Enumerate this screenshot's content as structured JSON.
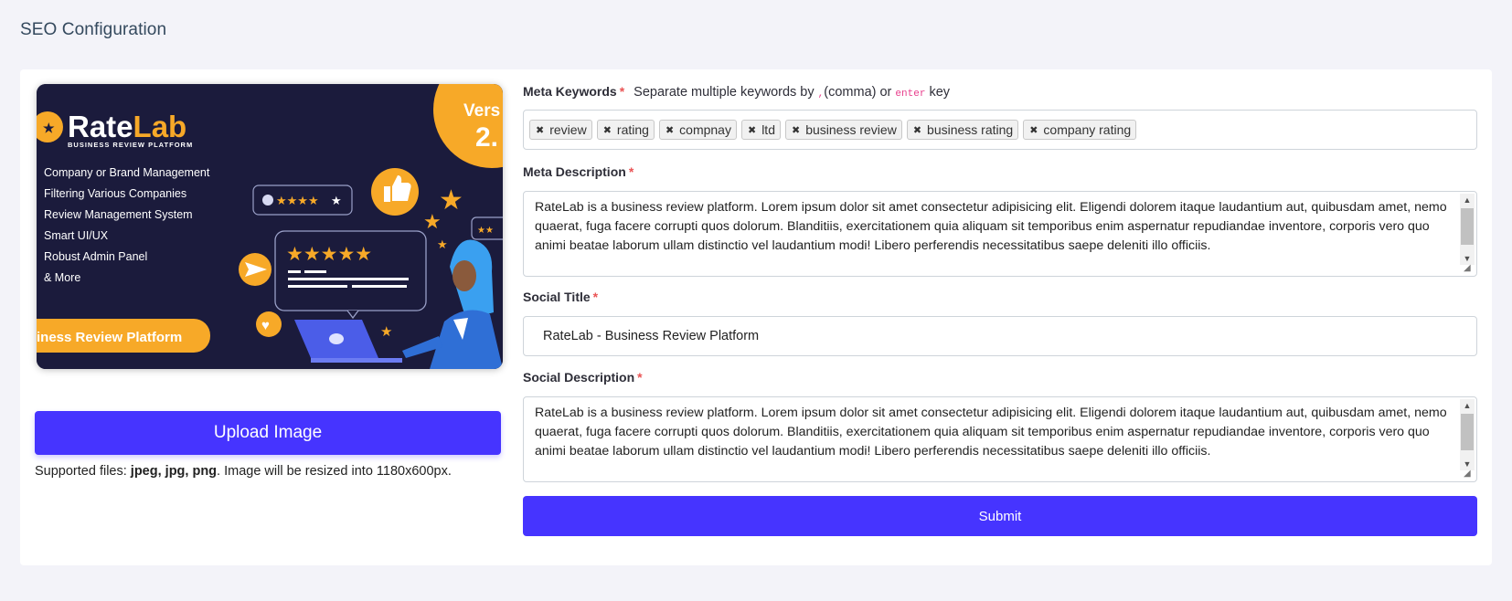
{
  "page": {
    "title": "SEO Configuration"
  },
  "image_panel": {
    "preview": {
      "brand_part1": "Rate",
      "brand_part2": "Lab",
      "tagline": "BUSINESS REVIEW PLATFORM",
      "features": [
        "Company or Brand Management",
        "Filtering Various Companies",
        "Review Management System",
        "Smart UI/UX",
        "Robust Admin Panel",
        "& More"
      ],
      "ribbon": "iness Review Platform",
      "version_word": "Vers",
      "version_number": "2.",
      "colors": {
        "background": "#1b1b3c",
        "accent": "#f7a928",
        "primary": "#4634ff"
      }
    },
    "upload_button": "Upload Image",
    "support_prefix": "Supported files: ",
    "support_formats": "jpeg, jpg, png",
    "support_suffix": ". Image will be resized into 1180x600px."
  },
  "form": {
    "meta_keywords": {
      "label": "Meta Keywords",
      "required_mark": "*",
      "hint_prefix": "Separate multiple keywords by ",
      "hint_comma": ",",
      "hint_middle": "(comma) or ",
      "hint_enter": "enter",
      "hint_suffix": " key",
      "tags": [
        "review",
        "rating",
        "compnay",
        "ltd",
        "business review",
        "business rating",
        "company rating"
      ]
    },
    "meta_description": {
      "label": "Meta Description",
      "required_mark": "*",
      "value": "RateLab is a business review platform. Lorem ipsum dolor sit amet consectetur adipisicing elit. Eligendi dolorem itaque laudantium aut, quibusdam amet, nemo quaerat, fuga facere corrupti quos dolorum. Blanditiis, exercitationem quia aliquam sit temporibus enim aspernatur repudiandae inventore, corporis vero quo animi beatae laborum ullam distinctio vel laudantium modi! Libero perferendis necessitatibus saepe deleniti illo officiis."
    },
    "social_title": {
      "label": "Social Title",
      "required_mark": "*",
      "value": "RateLab - Business Review Platform"
    },
    "social_description": {
      "label": "Social Description",
      "required_mark": "*",
      "value": "RateLab is a business review platform. Lorem ipsum dolor sit amet consectetur adipisicing elit. Eligendi dolorem itaque laudantium aut, quibusdam amet, nemo quaerat, fuga facere corrupti quos dolorum. Blanditiis, exercitationem quia aliquam sit temporibus enim aspernatur repudiandae inventore, corporis vero quo animi beatae laborum ullam distinctio vel laudantium modi! Libero perferendis necessitatibus saepe deleniti illo officiis."
    },
    "submit": "Submit"
  }
}
